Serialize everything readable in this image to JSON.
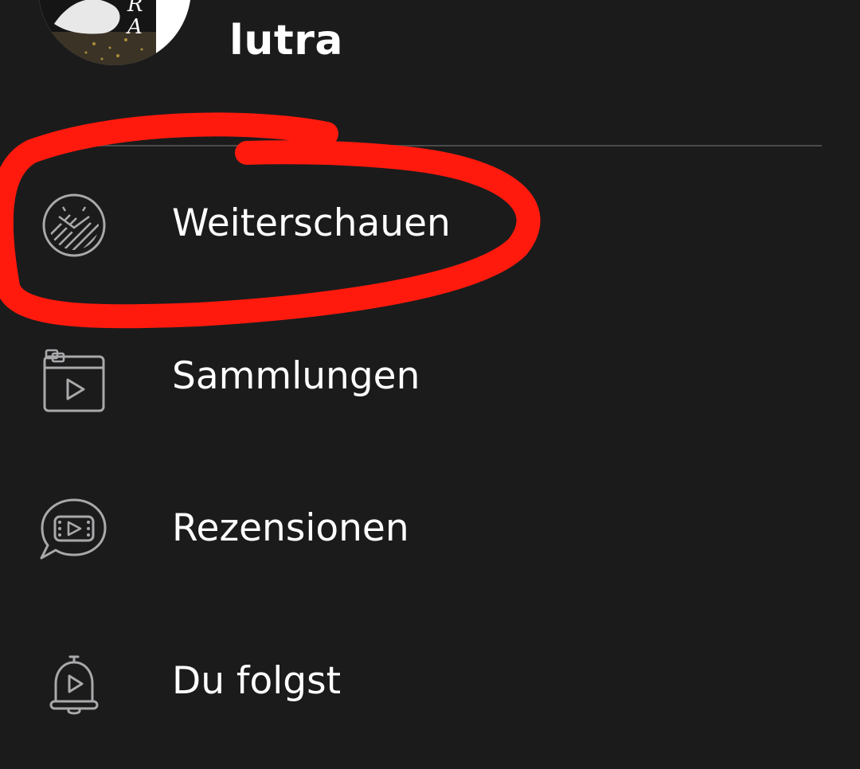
{
  "profile": {
    "username": "lutra"
  },
  "menu": {
    "items": [
      {
        "label": "Weiterschauen",
        "icon": "continue-watching-icon"
      },
      {
        "label": "Sammlungen",
        "icon": "collections-icon"
      },
      {
        "label": "Rezensionen",
        "icon": "reviews-icon"
      },
      {
        "label": "Du folgst",
        "icon": "following-bell-icon"
      }
    ]
  },
  "colors": {
    "background": "#1b1b1c",
    "text": "#ffffff",
    "icon": "#a9a9ab",
    "divider": "#4b4b4d",
    "annotation": "#ff1a0d"
  }
}
